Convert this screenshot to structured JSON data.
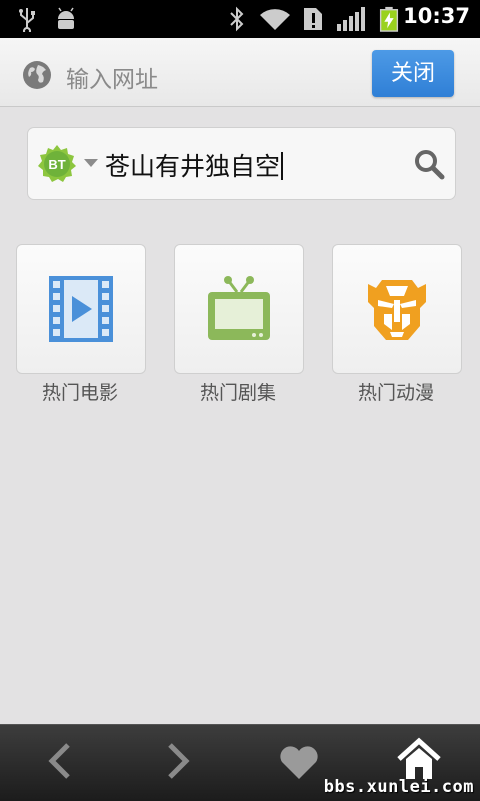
{
  "status_bar": {
    "time": "10:37",
    "icons": [
      "usb-icon",
      "android-debug-icon",
      "bluetooth-icon",
      "wifi-icon",
      "sim-alert-icon",
      "signal-icon",
      "battery-charging-icon"
    ]
  },
  "url_bar": {
    "placeholder": "输入网址",
    "close_label": "关闭",
    "icon": "globe-icon"
  },
  "search": {
    "engine_badge": "BT",
    "query": "苍山有井独自空",
    "icon": "search-icon"
  },
  "categories": [
    {
      "label": "热门电影",
      "icon": "film-icon",
      "color": "#4a90d9"
    },
    {
      "label": "热门剧集",
      "icon": "tv-icon",
      "color": "#8cb85a"
    },
    {
      "label": "热门动漫",
      "icon": "transformer-icon",
      "color": "#f0a020"
    }
  ],
  "toolbar": {
    "buttons": [
      "back-icon",
      "forward-icon",
      "favorites-icon",
      "home-icon"
    ]
  },
  "watermark": "bbs.xunlei.com"
}
